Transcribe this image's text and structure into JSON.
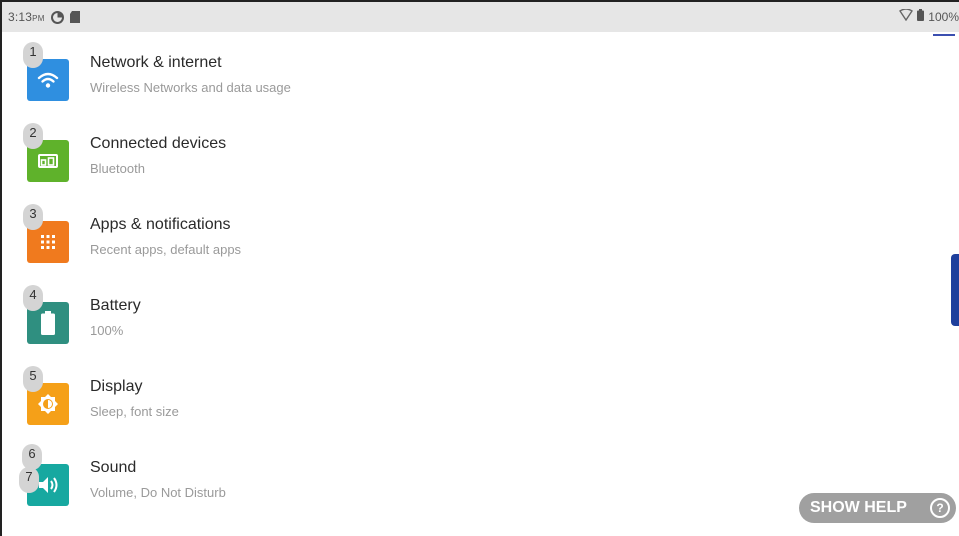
{
  "status_bar": {
    "time": "3:13",
    "ampm": "PM",
    "battery_percent": "100%"
  },
  "colors": {
    "network": "#2f8fe0",
    "connected": "#5fb22b",
    "apps": "#f07a1e",
    "battery": "#2f8f80",
    "display": "#f5a018",
    "sound": "#17a8a0",
    "side_tab": "#1f3f9c"
  },
  "items": [
    {
      "badge": "1",
      "title": "Network & internet",
      "subtitle": "Wireless Networks and data usage",
      "icon": "wifi-icon"
    },
    {
      "badge": "2",
      "title": "Connected devices",
      "subtitle": "Bluetooth",
      "icon": "devices-icon"
    },
    {
      "badge": "3",
      "title": "Apps & notifications",
      "subtitle": "Recent apps, default apps",
      "icon": "apps-grid-icon"
    },
    {
      "badge": "4",
      "title": "Battery",
      "subtitle": "100%",
      "icon": "battery-icon"
    },
    {
      "badge": "5",
      "title": "Display",
      "subtitle": "Sleep, font size",
      "icon": "brightness-icon"
    },
    {
      "badge": "6",
      "badge2": "7",
      "title": "Sound",
      "subtitle": "Volume, Do Not Disturb",
      "icon": "volume-icon"
    }
  ],
  "help": {
    "label": "SHOW HELP",
    "icon_text": "?"
  }
}
